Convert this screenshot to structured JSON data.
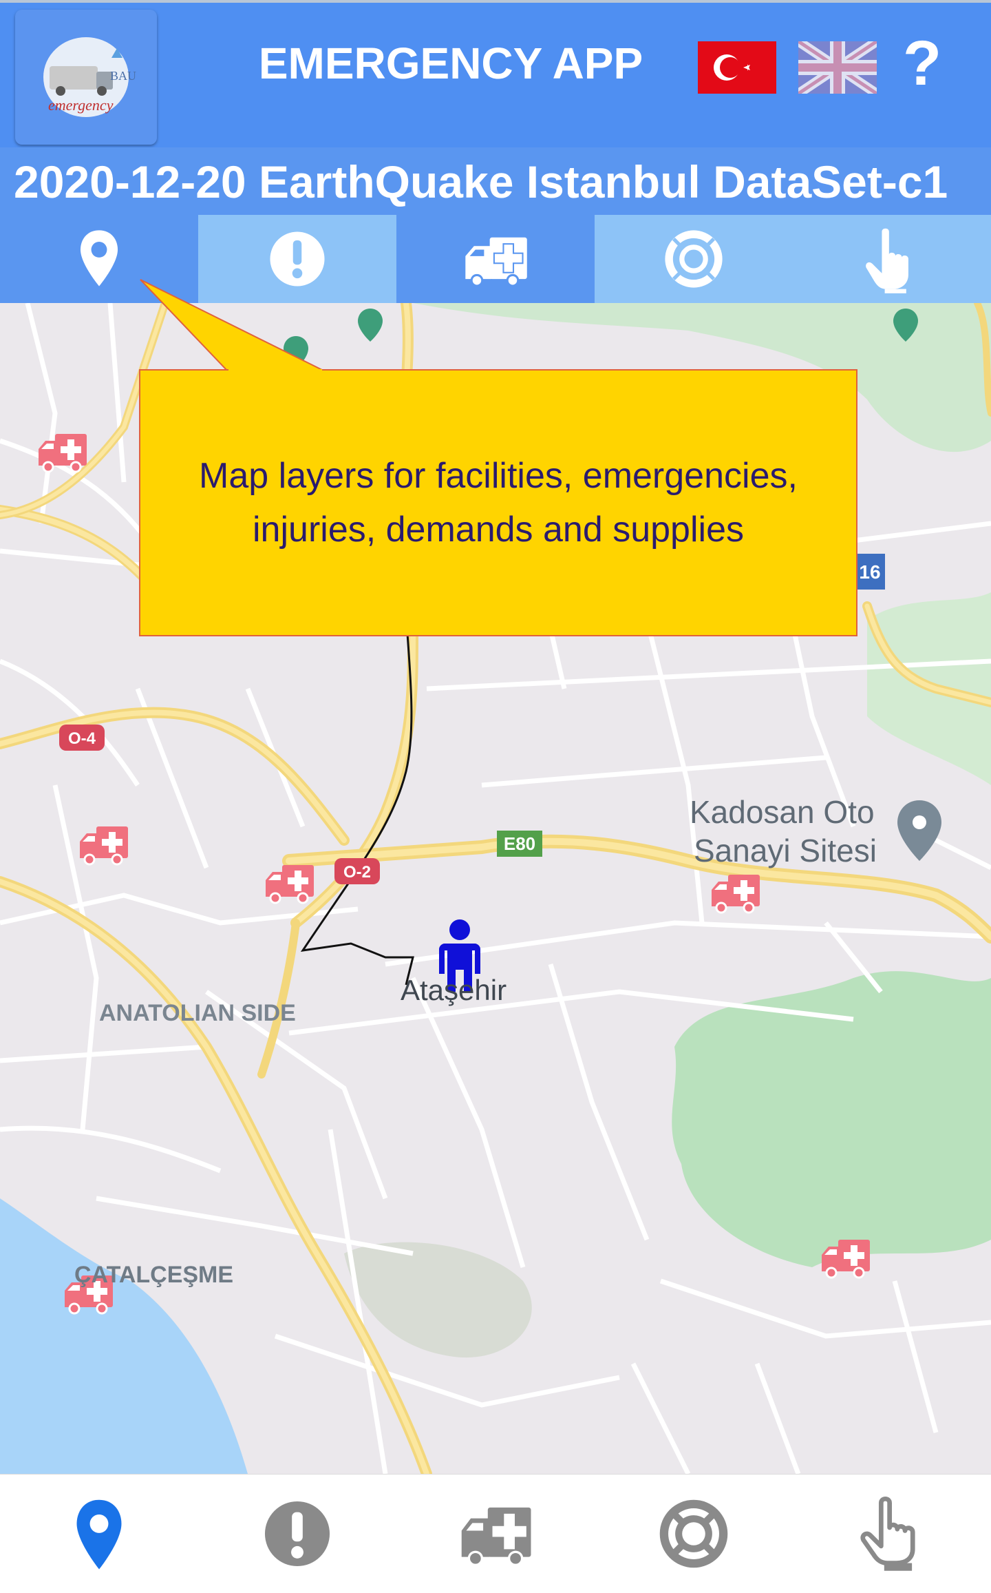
{
  "header": {
    "app_title": "EMERGENCY APP",
    "logo_text": "emergency",
    "logo_badge": "BAU",
    "help_label": "?",
    "languages": [
      "Turkish",
      "English"
    ]
  },
  "dataset": {
    "title": "2020-12-20 EarthQuake Istanbul DataSet-c1"
  },
  "layer_tabs": [
    {
      "name": "facilities",
      "icon": "map-pin-icon"
    },
    {
      "name": "emergencies",
      "icon": "exclamation-icon"
    },
    {
      "name": "injuries",
      "icon": "ambulance-icon"
    },
    {
      "name": "demands",
      "icon": "lifebuoy-icon"
    },
    {
      "name": "supplies",
      "icon": "hand-pointer-icon"
    }
  ],
  "tooltip": {
    "text": "Map layers for facilities, emergencies, injuries, demands and supplies"
  },
  "map": {
    "labels": {
      "kadosan_line1": "Kadosan Oto",
      "kadosan_line2": "Sanayi Sitesi",
      "atasehir": "Ataşehir",
      "anatolian_side": "ANATOLIAN SIDE",
      "catalcesme": "ÇATALÇEŞME"
    },
    "road_shields": {
      "e80": "E80",
      "o4": "O-4",
      "o2": "O-2",
      "d16": "16"
    },
    "markers": [
      "ambulance",
      "ambulance",
      "ambulance",
      "ambulance",
      "ambulance",
      "ambulance",
      "ambulance",
      "person"
    ]
  },
  "bottom_nav": [
    {
      "name": "facilities",
      "icon": "map-pin-icon",
      "active": true
    },
    {
      "name": "emergencies",
      "icon": "exclamation-icon",
      "active": false
    },
    {
      "name": "injuries",
      "icon": "ambulance-icon",
      "active": false
    },
    {
      "name": "demands",
      "icon": "lifebuoy-icon",
      "active": false
    },
    {
      "name": "supplies",
      "icon": "hand-pointer-icon",
      "active": false
    }
  ],
  "colors": {
    "header_bg": "#4f8ff2",
    "tooltip_bg": "#ffd400",
    "tooltip_text": "#2a1b6e",
    "active_nav": "#1a73e8",
    "inactive_nav": "#8a8a8a",
    "ambulance_marker": "#f0707e",
    "person_marker": "#1010d8"
  }
}
